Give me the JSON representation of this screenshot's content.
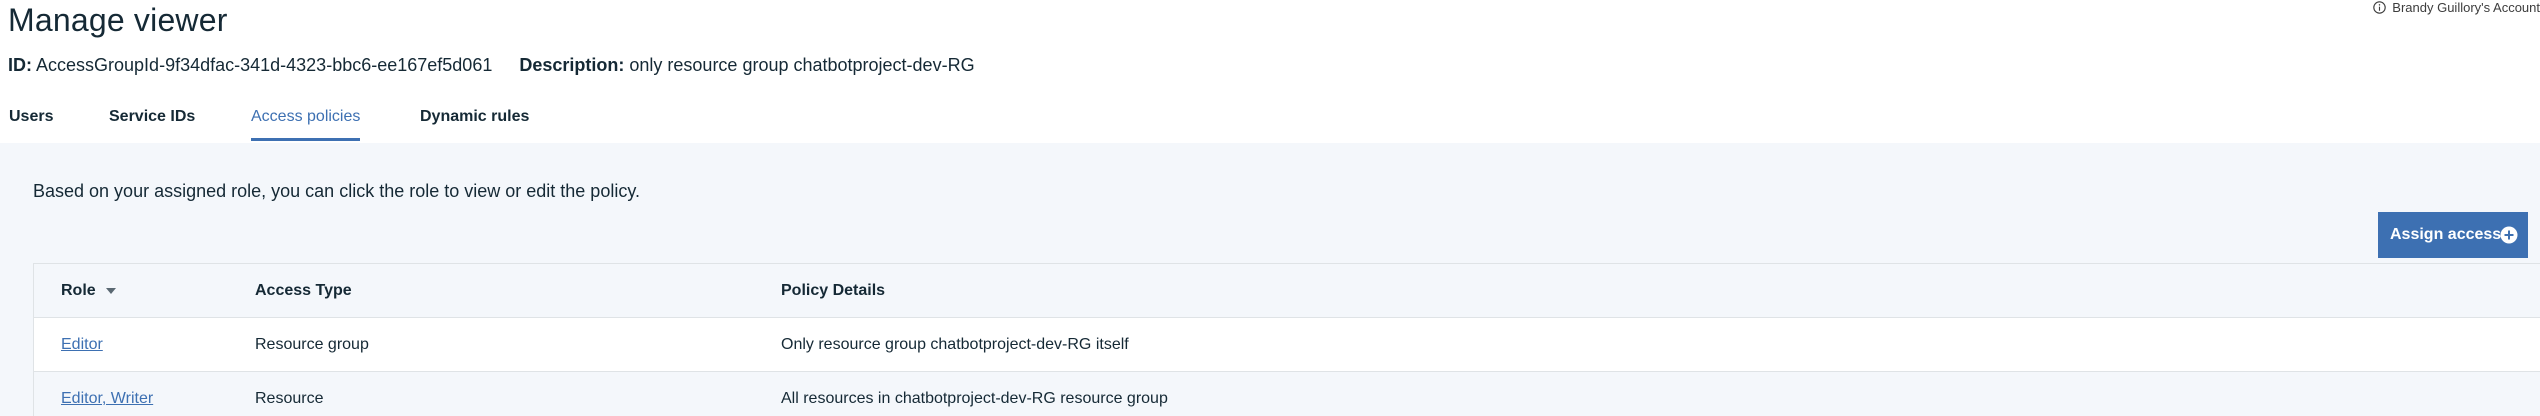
{
  "account": {
    "label": "Brandy Guillory's Account",
    "icon": "info-icon"
  },
  "page": {
    "title": "Manage viewer",
    "id_label": "ID:",
    "id_value": "AccessGroupId-9f34dfac-341d-4323-bbc6-ee167ef5d061",
    "description_label": "Description:",
    "description_value": "only resource group chatbotproject-dev-RG"
  },
  "tabs": [
    {
      "label": "Users",
      "active": false
    },
    {
      "label": "Service IDs",
      "active": false
    },
    {
      "label": "Access policies",
      "active": true
    },
    {
      "label": "Dynamic rules",
      "active": false
    }
  ],
  "panel": {
    "info_text": "Based on your assigned role, you can click the role to view or edit the policy.",
    "assign_button": "Assign access",
    "assign_icon": "add-circle-icon"
  },
  "table": {
    "headers": {
      "role": "Role",
      "access_type": "Access Type",
      "policy_details": "Policy Details"
    },
    "sort_icon": "caret-down-icon",
    "rows": [
      {
        "role": "Editor",
        "access_type": "Resource group",
        "policy_details": "Only resource group chatbotproject-dev-RG itself"
      },
      {
        "role": "Editor, Writer",
        "access_type": "Resource",
        "policy_details": "All resources in chatbotproject-dev-RG resource group"
      }
    ]
  },
  "colors": {
    "accent": "#3d70b2",
    "text": "#152935",
    "panel_bg": "#f4f7fb",
    "border": "#dfe3e6"
  }
}
